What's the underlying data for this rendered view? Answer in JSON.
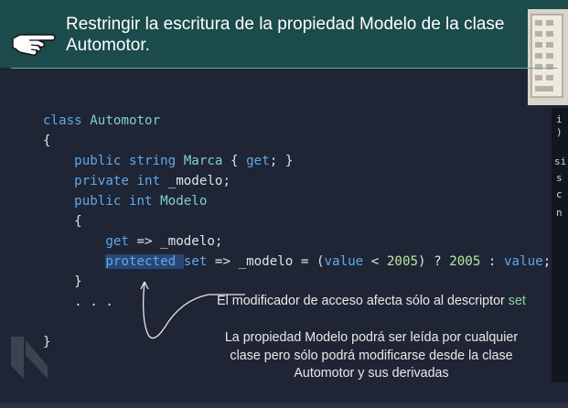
{
  "header": {
    "title": "Restringir la escritura de la propiedad Modelo de la clase Automotor.",
    "icon": "pointing-hand-icon",
    "background_color": "#1b4b4a"
  },
  "code": {
    "lines": [
      [
        {
          "t": "class ",
          "c": "kw"
        },
        {
          "t": "Automotor",
          "c": "ty"
        }
      ],
      [
        {
          "t": "{",
          "c": ""
        }
      ],
      [
        {
          "t": "    ",
          "c": ""
        },
        {
          "t": "public ",
          "c": "kw"
        },
        {
          "t": "string ",
          "c": "kw"
        },
        {
          "t": "Marca",
          "c": "ty"
        },
        {
          "t": " { ",
          "c": ""
        },
        {
          "t": "get",
          "c": "kw"
        },
        {
          "t": "; }",
          "c": ""
        }
      ],
      [
        {
          "t": "    ",
          "c": ""
        },
        {
          "t": "private ",
          "c": "kw"
        },
        {
          "t": "int ",
          "c": "kw"
        },
        {
          "t": "_modelo;",
          "c": ""
        }
      ],
      [
        {
          "t": "    ",
          "c": ""
        },
        {
          "t": "public ",
          "c": "kw"
        },
        {
          "t": "int ",
          "c": "kw"
        },
        {
          "t": "Modelo",
          "c": "ty"
        }
      ],
      [
        {
          "t": "    {",
          "c": ""
        }
      ],
      [
        {
          "t": "        ",
          "c": ""
        },
        {
          "t": "get",
          "c": "kw"
        },
        {
          "t": " => _modelo;",
          "c": ""
        }
      ],
      [
        {
          "t": "        ",
          "c": ""
        },
        {
          "t": "protected ",
          "c": "hl"
        },
        {
          "t": "set",
          "c": "kw"
        },
        {
          "t": " => _modelo = (",
          "c": ""
        },
        {
          "t": "value",
          "c": "kw"
        },
        {
          "t": " < ",
          "c": ""
        },
        {
          "t": "2005",
          "c": "num"
        },
        {
          "t": ") ? ",
          "c": ""
        },
        {
          "t": "2005",
          "c": "num"
        },
        {
          "t": " : ",
          "c": ""
        },
        {
          "t": "value",
          "c": "kw"
        },
        {
          "t": ";",
          "c": ""
        }
      ],
      [
        {
          "t": "    }",
          "c": ""
        }
      ],
      [
        {
          "t": "    . . .",
          "c": ""
        }
      ],
      [
        {
          "t": "",
          "c": ""
        }
      ],
      [
        {
          "t": "}",
          "c": ""
        }
      ]
    ]
  },
  "annotation": {
    "line1_prefix": "El modificador de acceso afecta sólo al descriptor ",
    "line1_keyword": "set",
    "line2": "La propiedad Modelo podrá ser leída por cualquier clase pero sólo podrá modificarse desde la clase Automotor y sus derivadas"
  },
  "edge_fragments": [
    "i",
    ")",
    "si",
    "s",
    "c",
    "n"
  ],
  "colors": {
    "keyword": "#5fa8ea",
    "type": "#7fd0c8",
    "number": "#bde7a1",
    "highlight": "#294774",
    "set_word": "#8ed49b"
  }
}
